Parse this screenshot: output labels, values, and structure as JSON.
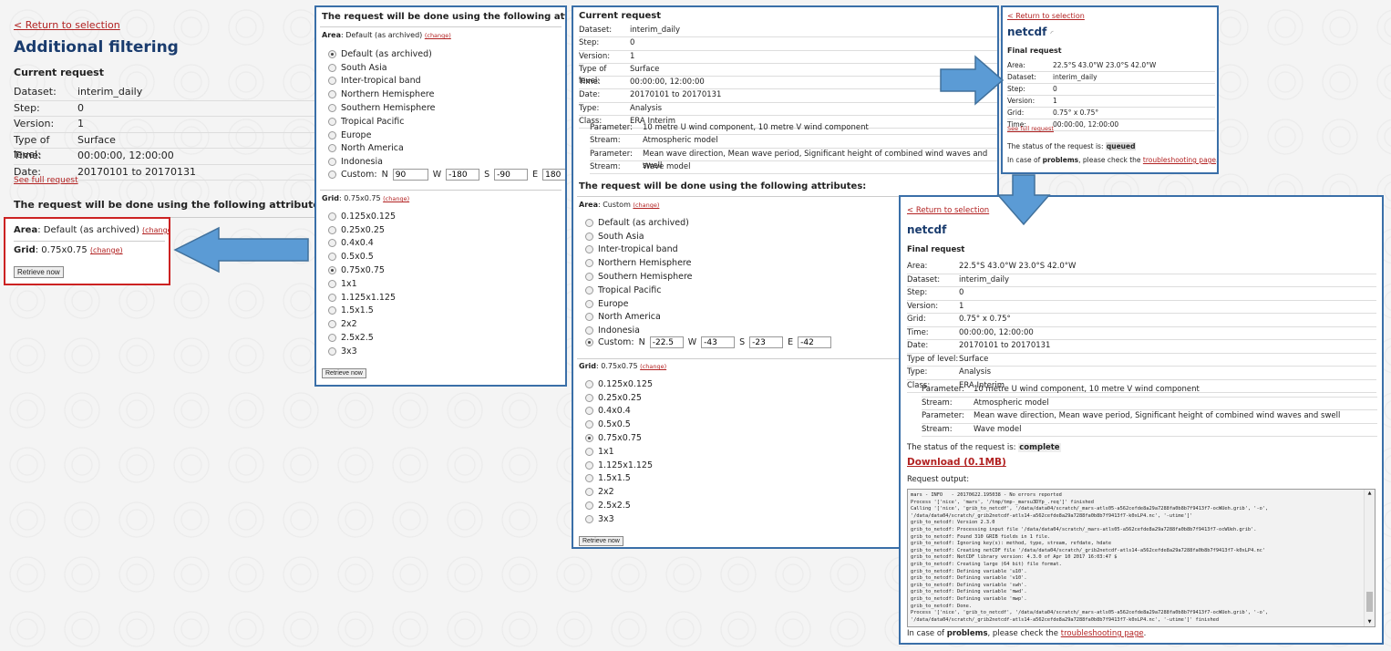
{
  "left": {
    "return_link": "< Return to selection",
    "title": "Additional filtering",
    "current_request_h": "Current request",
    "rows": [
      {
        "k": "Dataset:",
        "v": "interim_daily"
      },
      {
        "k": "Step:",
        "v": "0"
      },
      {
        "k": "Version:",
        "v": "1"
      },
      {
        "k": "Type of level:",
        "v": "Surface"
      },
      {
        "k": "Time:",
        "v": "00:00:00, 12:00:00"
      },
      {
        "k": "Date:",
        "v": "20170101 to 20170131"
      }
    ],
    "see_full": "See full request",
    "attrs_h": "The request will be done using the following attributes:",
    "area_label": "Area",
    "area_value": ": Default (as archived)",
    "grid_label": "Grid",
    "grid_value": ": 0.75x0.75",
    "change": "(change)",
    "retrieve": "Retrieve now"
  },
  "p2": {
    "header": "The request will be done using the following attributes:",
    "area_label": "Area",
    "area_value": ": Default (as archived)",
    "change": "(change)",
    "areas": [
      "Default (as archived)",
      "South Asia",
      "Inter-tropical band",
      "Northern Hemisphere",
      "Southern Hemisphere",
      "Tropical Pacific",
      "Europe",
      "North America",
      "Indonesia"
    ],
    "custom_label": "Custom:",
    "n": "90",
    "w": "-180",
    "s": "-90",
    "e": "180",
    "grid_label": "Grid",
    "grid_value": ": 0.75x0.75",
    "grids": [
      "0.125x0.125",
      "0.25x0.25",
      "0.4x0.4",
      "0.5x0.5",
      "0.75x0.75",
      "1x1",
      "1.125x1.125",
      "1.5x1.5",
      "2x2",
      "2.5x2.5",
      "3x3"
    ],
    "retrieve": "Retrieve now"
  },
  "p3": {
    "header": "Current request",
    "rows": [
      {
        "k": "Dataset:",
        "v": "interim_daily"
      },
      {
        "k": "Step:",
        "v": "0"
      },
      {
        "k": "Version:",
        "v": "1"
      },
      {
        "k": "Type of level:",
        "v": "Surface"
      },
      {
        "k": "Time:",
        "v": "00:00:00, 12:00:00"
      },
      {
        "k": "Date:",
        "v": "20170101 to 20170131"
      },
      {
        "k": "Type:",
        "v": "Analysis"
      },
      {
        "k": "Class:",
        "v": "ERA Interim"
      }
    ],
    "sub": [
      {
        "k": "Parameter:",
        "v": "10 metre U wind component, 10 metre V wind component"
      },
      {
        "k": "Stream:",
        "v": "Atmospheric model"
      },
      {
        "k": "Parameter:",
        "v": "Mean wave direction, Mean wave period, Significant height of combined wind waves and swell"
      },
      {
        "k": "Stream:",
        "v": "Wave model"
      }
    ],
    "attrs_h": "The request will be done using the following attributes:",
    "area_label": "Area",
    "area_value": ": Custom",
    "change": "(change)",
    "areas": [
      "Default (as archived)",
      "South Asia",
      "Inter-tropical band",
      "Northern Hemisphere",
      "Southern Hemisphere",
      "Tropical Pacific",
      "Europe",
      "North America",
      "Indonesia"
    ],
    "custom_label": "Custom:",
    "n": "-22.5",
    "w": "-43",
    "s": "-23",
    "e": "-42",
    "grid_label": "Grid",
    "grid_value": ": 0.75x0.75",
    "grids": [
      "0.125x0.125",
      "0.25x0.25",
      "0.4x0.4",
      "0.5x0.5",
      "0.75x0.75",
      "1x1",
      "1.125x1.125",
      "1.5x1.5",
      "2x2",
      "2.5x2.5",
      "3x3"
    ],
    "retrieve": "Retrieve now"
  },
  "p4": {
    "return_link": "< Return to selection",
    "title": "netcdf",
    "final_h": "Final request",
    "rows": [
      {
        "k": "Area:",
        "v": "22.5°S 43.0°W 23.0°S 42.0°W"
      },
      {
        "k": "Dataset:",
        "v": "interim_daily"
      },
      {
        "k": "Step:",
        "v": "0"
      },
      {
        "k": "Version:",
        "v": "1"
      },
      {
        "k": "Grid:",
        "v": "0.75° x 0.75°"
      },
      {
        "k": "Time:",
        "v": "00:00:00, 12:00:00"
      }
    ],
    "see_full": "See full request",
    "status_prefix": "The status of the request is: ",
    "status": "queued",
    "problems_a": "In case of ",
    "problems_b": "problems",
    "problems_c": ", please check the ",
    "trouble": "troubleshooting page",
    "dot": "."
  },
  "p5": {
    "return_link": "< Return to selection",
    "title": "netcdf",
    "final_h": "Final request",
    "rows": [
      {
        "k": "Area:",
        "v": "22.5°S 43.0°W 23.0°S 42.0°W"
      },
      {
        "k": "Dataset:",
        "v": "interim_daily"
      },
      {
        "k": "Step:",
        "v": "0"
      },
      {
        "k": "Version:",
        "v": "1"
      },
      {
        "k": "Grid:",
        "v": "0.75° x 0.75°"
      },
      {
        "k": "Time:",
        "v": "00:00:00, 12:00:00"
      },
      {
        "k": "Date:",
        "v": "20170101 to 20170131"
      },
      {
        "k": "Type of level:",
        "v": "Surface"
      },
      {
        "k": "Type:",
        "v": "Analysis"
      },
      {
        "k": "Class:",
        "v": "ERA Interim"
      }
    ],
    "sub": [
      {
        "k": "Parameter:",
        "v": "10 metre U wind component, 10 metre V wind component"
      },
      {
        "k": "Stream:",
        "v": "Atmospheric model"
      },
      {
        "k": "Parameter:",
        "v": "Mean wave direction, Mean wave period, Significant height of combined wind waves and swell"
      },
      {
        "k": "Stream:",
        "v": "Wave model"
      }
    ],
    "status_prefix": "The status of the request is: ",
    "status": "complete",
    "download": "Download (0.1MB)",
    "output_label": "Request output:",
    "output": "mars - INFO   - 20170622.195038 - No errors reported\nProcess '['nice', 'mars', '/tmp/tmp-_marsu3DYp_.req']' finished\nCalling '['nice', 'grib_to_netcdf', '/data/data04/scratch/_mars-atls05-a562cefde8a29a7288fa0b8b7f9413f7-ocWUeh.grib', '-o',\n'/data/data04/scratch/_grib2netcdf-atls14-a562cefde8a29a7288fa0b8b7f9413f7-k0xLP4.nc', '-utime']'\ngrib_to_netcdf: Version 2.3.0\ngrib_to_netcdf: Processing input file '/data/data04/scratch/_mars-atls05-a562cefde8a29a7288fa0b8b7f9413f7-ocWUeh.grib'.\ngrib_to_netcdf: Found 310 GRIB fields in 1 file.\ngrib_to_netcdf: Ignoring key(s): method, type, stream, refdate, hdate\ngrib_to_netcdf: Creating netCDF file '/data/data04/scratch/_grib2netcdf-atls14-a562cefde8a29a7288fa0b8b7f9413f7-k0xLP4.nc'\ngrib_to_netcdf: NetCDF library version: 4.3.0 of Apr 10 2017 16:03:47 $\ngrib_to_netcdf: Creating large (64 bit) file format.\ngrib_to_netcdf: Defining variable 'u10'.\ngrib_to_netcdf: Defining variable 'v10'.\ngrib_to_netcdf: Defining variable 'swh'.\ngrib_to_netcdf: Defining variable 'mwd'.\ngrib_to_netcdf: Defining variable 'mwp'.\ngrib_to_netcdf: Done.\nProcess '['nice', 'grib_to_netcdf', '/data/data04/scratch/_mars-atls05-a562cefde8a29a7288fa0b8b7f9413f7-ocWUeh.grib', '-o',\n'/data/data04/scratch/_grib2netcdf-atls14-a562cefde8a29a7288fa0b8b7f9413f7-k0xLP4.nc', '-utime']' finished",
    "problems_a": "In case of ",
    "problems_b": "problems",
    "problems_c": ", please check the ",
    "trouble": "troubleshooting page",
    "dot": "."
  },
  "colors": {
    "arrow": "#5b9bd5",
    "arrow_border": "#41719c",
    "panel_border": "#3a6fa8",
    "highlight_border": "#cc2222",
    "link": "#b22222",
    "title": "#1a3c6e"
  }
}
